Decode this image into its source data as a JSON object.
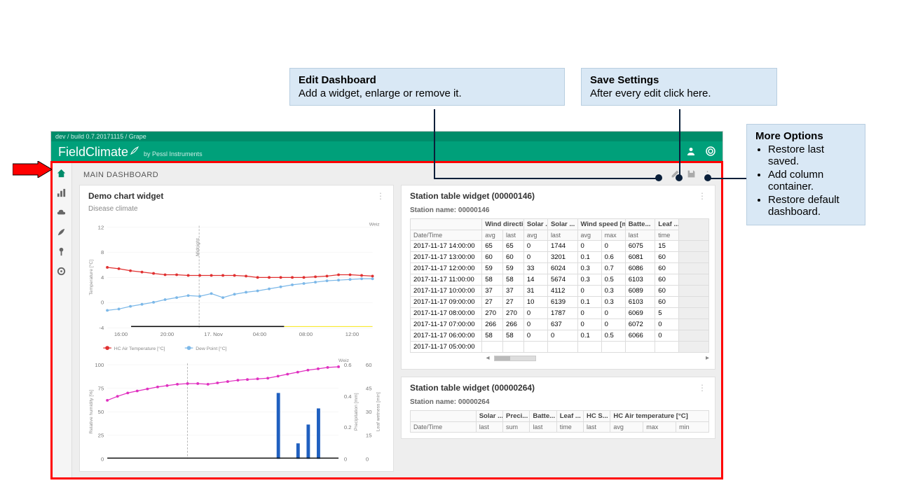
{
  "callouts": {
    "edit": {
      "title": "Edit Dashboard",
      "text": "Add a widget, enlarge or remove it."
    },
    "save": {
      "title": "Save Settings",
      "text": "After every edit click here."
    },
    "more": {
      "title": "More Options",
      "items": [
        "Restore last saved.",
        "Add column container.",
        "Restore default dashboard."
      ]
    }
  },
  "app": {
    "build": "dev / build 0.7.20171115 / Grape",
    "logo": "FieldClimate",
    "logo_sub": "by Pessl Instruments",
    "dash_title": "MAIN DASHBOARD"
  },
  "chart_widget": {
    "title": "Demo chart widget",
    "subtitle": "Disease climate",
    "station_label": "Weiz",
    "midnight_label": "Midnight"
  },
  "chart_data": [
    {
      "type": "line",
      "title": "Disease climate",
      "ylabel": "Temperature [°C]",
      "ylim": [
        -4,
        12
      ],
      "xticks": [
        "16:00",
        "20:00",
        "17. Nov",
        "04:00",
        "08:00",
        "12:00"
      ],
      "midnight_x_index": 2,
      "series": [
        {
          "name": "HC Air Temperature [°C]",
          "color": "#e03030",
          "values": [
            5.5,
            5.3,
            5.0,
            4.8,
            4.6,
            4.4,
            4.4,
            4.3,
            4.3,
            4.3,
            4.3,
            4.3,
            4.2,
            4.0,
            4.0,
            4.0,
            4.0,
            4.0,
            4.1,
            4.2,
            4.4,
            4.4,
            4.3,
            4.2
          ]
        },
        {
          "name": "Dew Point [°C]",
          "color": "#7cb8e8",
          "values": [
            -1.2,
            -1.0,
            -0.6,
            -0.3,
            0.0,
            0.5,
            0.8,
            1.1,
            1.0,
            1.4,
            0.8,
            1.3,
            1.6,
            1.9,
            2.2,
            2.5,
            2.8,
            3.0,
            3.2,
            3.4,
            3.5,
            3.6,
            3.7,
            3.8
          ]
        }
      ],
      "legend": [
        "HC Air Temperature [°C]",
        "Dew Point [°C]"
      ]
    },
    {
      "type": "combo",
      "ylabel_left": "Relative humidity [%]",
      "ylabel_right1": "Precipitation [mm]",
      "ylabel_right2": "Leaf wetness [min]",
      "ylim_left": [
        0,
        100
      ],
      "ylim_right1": [
        0,
        0.6
      ],
      "ylim_right2": [
        0,
        60
      ],
      "yticks_left": [
        0,
        25,
        50,
        75,
        100
      ],
      "yticks_right1": [
        0,
        0.2,
        0.4,
        0.6
      ],
      "yticks_right2": [
        0,
        15,
        30,
        45,
        60
      ],
      "series_line": {
        "name": "Relative humidity",
        "color": "#e030c0",
        "values": [
          62,
          66,
          70,
          72,
          74,
          76,
          78,
          79,
          80,
          80,
          79,
          81,
          82,
          83,
          84,
          85,
          86,
          88,
          90,
          92,
          94,
          96,
          97,
          98
        ]
      },
      "bars": {
        "name": "Precipitation",
        "indices": [
          17,
          19,
          20,
          21
        ],
        "values": [
          0.42,
          0.1,
          0.22,
          0.32
        ]
      }
    }
  ],
  "table1": {
    "title": "Station table widget (00000146)",
    "station": "Station name: 00000146",
    "group_headers": [
      "",
      "Wind direction [...",
      "Solar ...",
      "Solar ...",
      "Wind speed [m/s]",
      "Batte...",
      "Leaf ..."
    ],
    "sub_headers": [
      "Date/Time",
      "avg",
      "last",
      "avg",
      "last",
      "avg",
      "max",
      "last",
      "time"
    ],
    "rows": [
      [
        "2017-11-17 14:00:00",
        "65",
        "65",
        "0",
        "1744",
        "0",
        "0",
        "6075",
        "15"
      ],
      [
        "2017-11-17 13:00:00",
        "60",
        "60",
        "0",
        "3201",
        "0.1",
        "0.6",
        "6081",
        "60"
      ],
      [
        "2017-11-17 12:00:00",
        "59",
        "59",
        "33",
        "6024",
        "0.3",
        "0.7",
        "6086",
        "60"
      ],
      [
        "2017-11-17 11:00:00",
        "58",
        "58",
        "14",
        "5674",
        "0.3",
        "0.5",
        "6103",
        "60"
      ],
      [
        "2017-11-17 10:00:00",
        "37",
        "37",
        "31",
        "4112",
        "0",
        "0.3",
        "6089",
        "60"
      ],
      [
        "2017-11-17 09:00:00",
        "27",
        "27",
        "10",
        "6139",
        "0.1",
        "0.3",
        "6103",
        "60"
      ],
      [
        "2017-11-17 08:00:00",
        "270",
        "270",
        "0",
        "1787",
        "0",
        "0",
        "6069",
        "5"
      ],
      [
        "2017-11-17 07:00:00",
        "266",
        "266",
        "0",
        "637",
        "0",
        "0",
        "6072",
        "0"
      ],
      [
        "2017-11-17 06:00:00",
        "58",
        "58",
        "0",
        "0",
        "0.1",
        "0.5",
        "6066",
        "0"
      ],
      [
        "2017-11-17 05:00:00",
        "",
        "",
        "",
        "",
        "",
        "",
        "",
        ""
      ]
    ]
  },
  "table2": {
    "title": "Station table widget (00000264)",
    "station": "Station name: 00000264",
    "group_headers": [
      "",
      "Solar ...",
      "Preci...",
      "Batte...",
      "Leaf ...",
      "HC S...",
      "HC Air temperature [°C]"
    ],
    "sub_headers": [
      "Date/Time",
      "last",
      "sum",
      "last",
      "time",
      "last",
      "avg",
      "max",
      "min"
    ]
  }
}
